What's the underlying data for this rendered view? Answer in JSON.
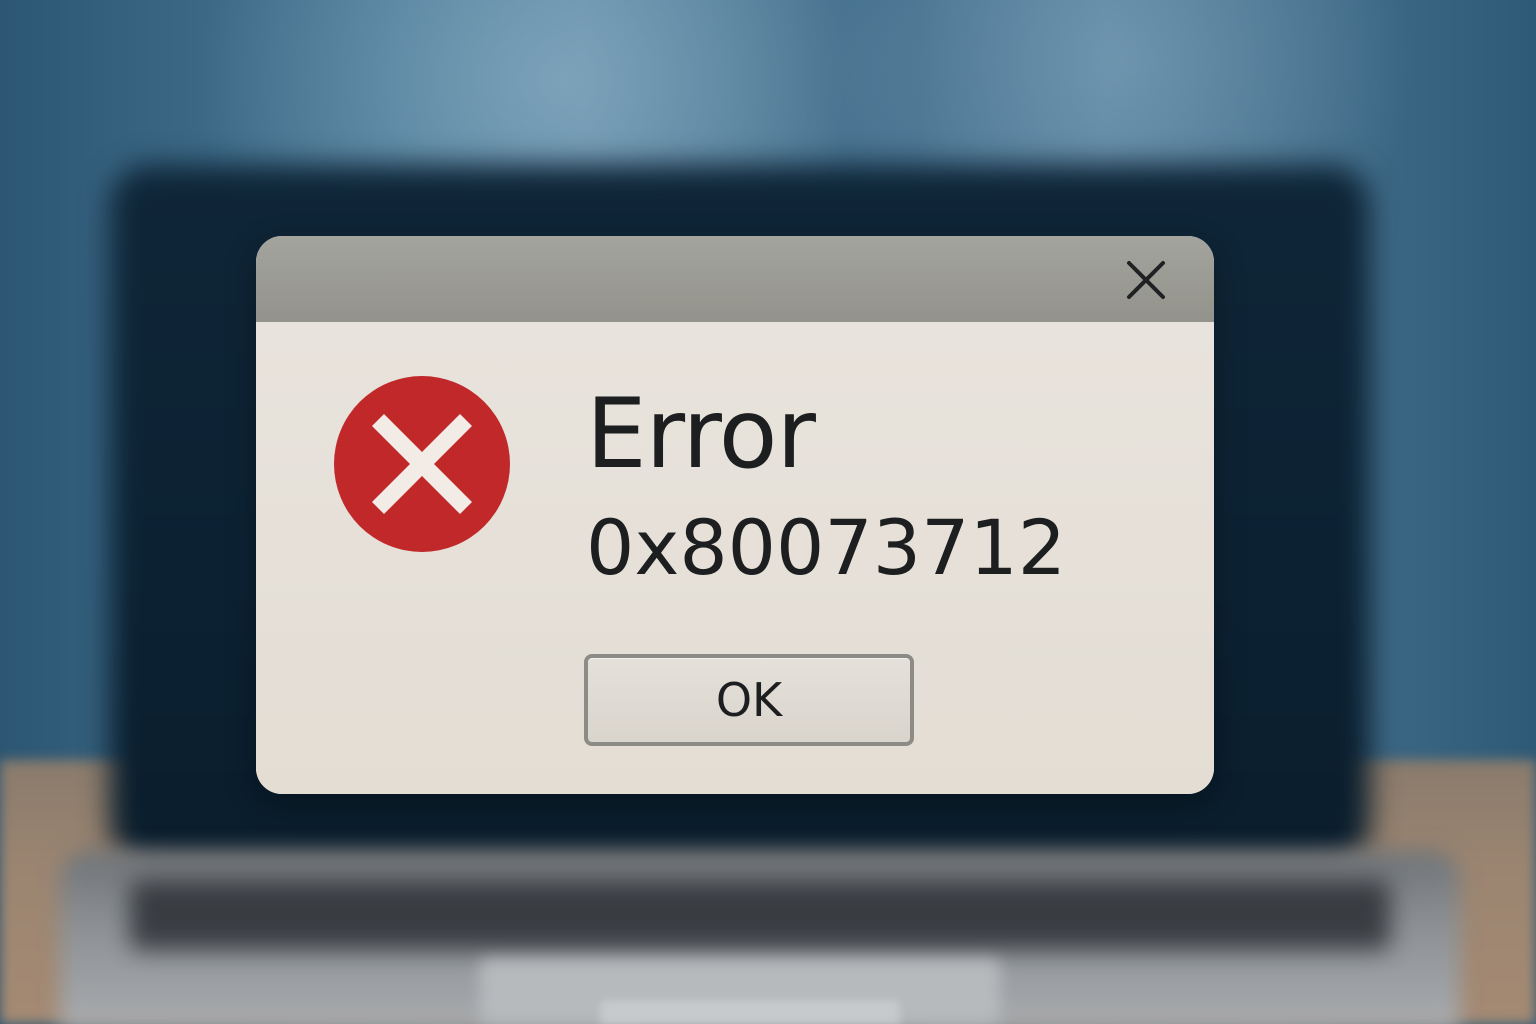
{
  "dialog": {
    "title": "Error",
    "error_code": "0x80073712",
    "ok_label": "OK",
    "icons": {
      "close": "close-icon",
      "status": "error-icon"
    }
  },
  "colors": {
    "error_red": "#c0282a",
    "titlebar": "#9c9c95",
    "dialog_body": "#e6e0d8",
    "text": "#1c1e1f"
  }
}
